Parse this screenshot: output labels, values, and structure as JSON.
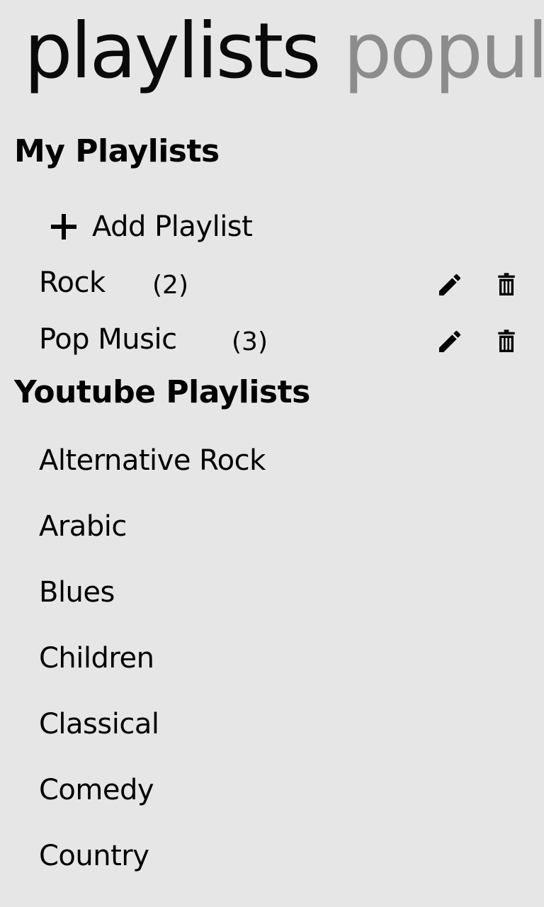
{
  "pivot": {
    "active": "playlists",
    "next": "popular"
  },
  "my_playlists": {
    "title": "My Playlists",
    "add_label": "Add Playlist",
    "items": [
      {
        "name": "Rock",
        "count": "(2)"
      },
      {
        "name": "Pop Music",
        "count": "(3)"
      }
    ]
  },
  "youtube_playlists": {
    "title": "Youtube Playlists",
    "items": [
      "Alternative Rock",
      "Arabic",
      "Blues",
      "Children",
      "Classical",
      "Comedy",
      "Country"
    ]
  },
  "icons": {
    "add": "plus-icon",
    "edit": "pencil-icon",
    "delete": "trash-icon"
  },
  "colors": {
    "background": "#e6e6e6",
    "active_text": "#0a0a0a",
    "inactive_pivot": "#8c8c8c"
  }
}
